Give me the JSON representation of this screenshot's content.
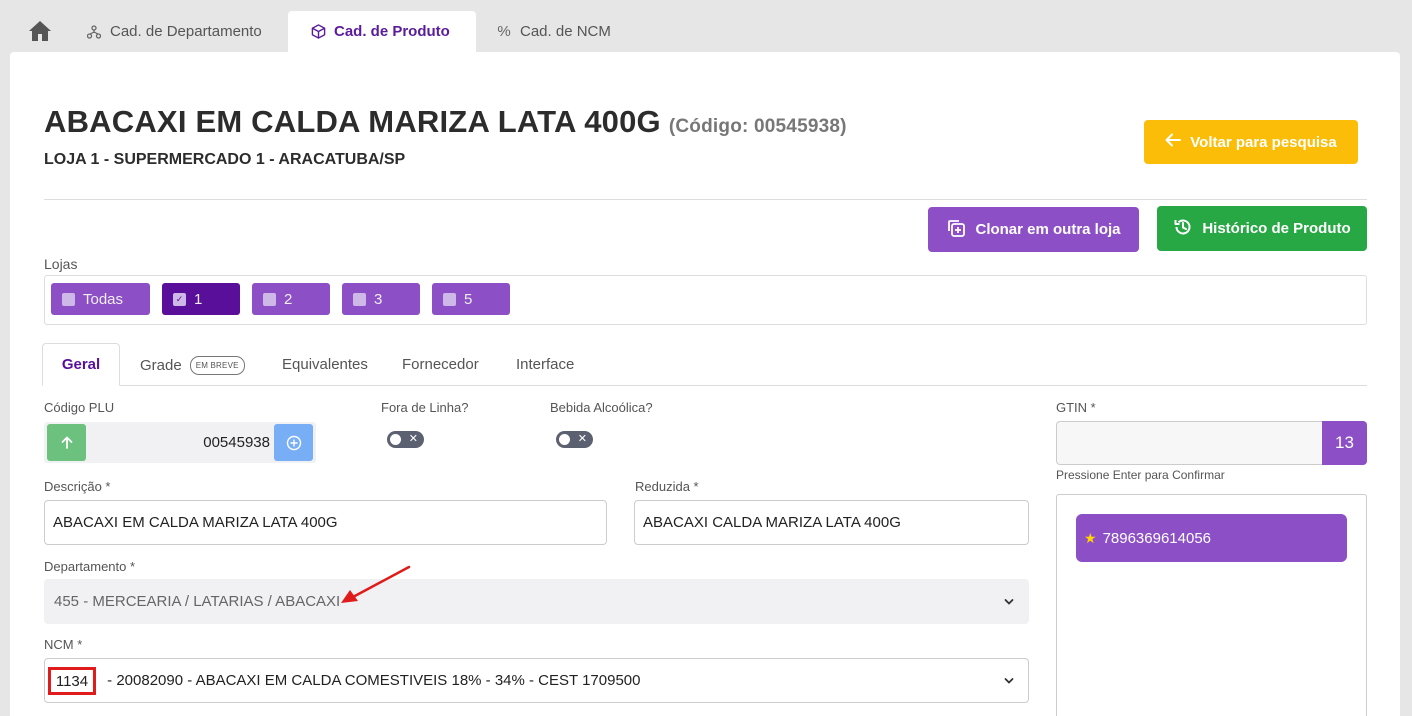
{
  "top_tabs": [
    {
      "label": "Cad. de Departamento",
      "icon": "sitemap-icon"
    },
    {
      "label": "Cad. de Produto",
      "icon": "box-icon"
    },
    {
      "label": "Cad. de NCM",
      "icon": "percent-icon"
    }
  ],
  "header": {
    "title": "ABACAXI EM CALDA MARIZA LATA 400G",
    "codigo": "(Código: 00545938)",
    "subtitle": "LOJA 1 - SUPERMERCADO 1 - ARACATUBA/SP",
    "voltar_label": "Voltar para pesquisa"
  },
  "actions": {
    "clonar_label": "Clonar em outra loja",
    "historico_label": "Histórico de Produto"
  },
  "lojas": {
    "label": "Lojas",
    "items": [
      {
        "label": "Todas",
        "checked": false
      },
      {
        "label": "1",
        "checked": true
      },
      {
        "label": "2",
        "checked": false
      },
      {
        "label": "3",
        "checked": false
      },
      {
        "label": "5",
        "checked": false
      }
    ]
  },
  "inner_tabs": {
    "geral": "Geral",
    "grade": "Grade",
    "grade_badge": "EM BREVE",
    "equivalentes": "Equivalentes",
    "fornecedor": "Fornecedor",
    "interface": "Interface"
  },
  "form": {
    "codigo_plu_label": "Código PLU",
    "codigo_plu_value": "00545938",
    "fora_linha_label": "Fora de Linha?",
    "fora_linha": false,
    "bebida_label": "Bebida Alcoólica?",
    "bebida": false,
    "descricao_label": "Descrição *",
    "descricao_value": "ABACAXI EM CALDA MARIZA LATA 400G",
    "reduzida_label": "Reduzida *",
    "reduzida_value": "ABACAXI CALDA MARIZA LATA 400G",
    "departamento_label": "Departamento *",
    "departamento_value": "455 - MERCEARIA / LATARIAS / ABACAXI",
    "ncm_label": "NCM *",
    "ncm_code": "1134",
    "ncm_rest": " - 20082090 - ABACAXI EM CALDA COMESTIVEIS 18% - 34% - CEST 1709500"
  },
  "gtin": {
    "label": "GTIN *",
    "count": "13",
    "hint": "Pressione Enter para Confirmar",
    "items": [
      "7896369614056"
    ]
  },
  "colors": {
    "purple": "#8c4fc6",
    "purple_dark": "#5a0f9a",
    "yellow": "#fbbd08",
    "green": "#28a745",
    "annotation_red": "#e01b1b"
  }
}
